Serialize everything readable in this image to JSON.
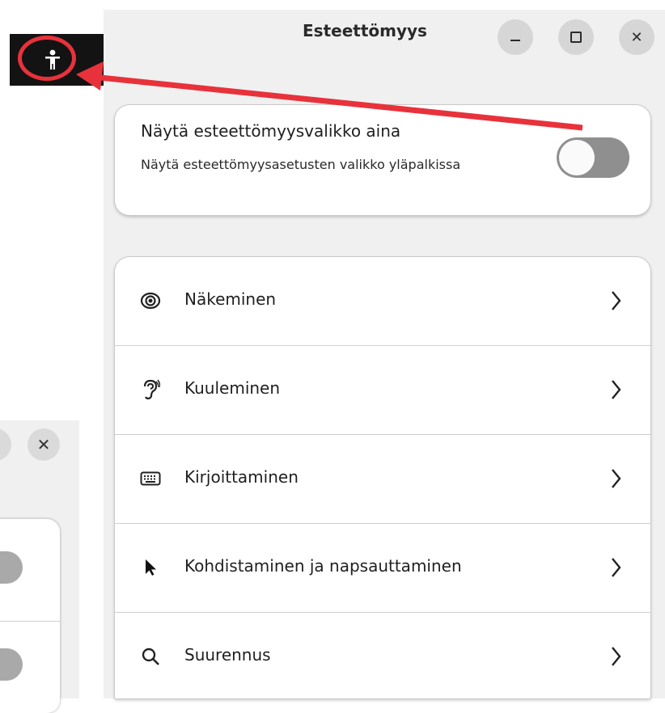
{
  "window": {
    "title": "Esteettömyys",
    "buttons": [
      "minimize-icon",
      "maximize-icon",
      "close-icon"
    ]
  },
  "topbar": {
    "icons": [
      "accessibility-icon",
      "wifi-icon",
      "volume-icon",
      "battery-charging-icon"
    ]
  },
  "always_show_menu": {
    "title": "Näytä esteettömyysvalikko aina",
    "subtitle": "Näytä esteettömyysasetusten valikko yläpalkissa",
    "enabled": false
  },
  "categories": [
    {
      "label": "Näkeminen",
      "icon": "eye-icon"
    },
    {
      "label": "Kuuleminen",
      "icon": "ear-icon"
    },
    {
      "label": "Kirjoittaminen",
      "icon": "keyboard-icon"
    },
    {
      "label": "Kohdistaminen ja napsauttaminen",
      "icon": "pointer-icon"
    },
    {
      "label": "Suurennus",
      "icon": "magnifier-icon"
    }
  ],
  "colors": {
    "annotation": "#e8323b",
    "toggle_off": "#8f8f8f",
    "topbar": "#131313"
  }
}
